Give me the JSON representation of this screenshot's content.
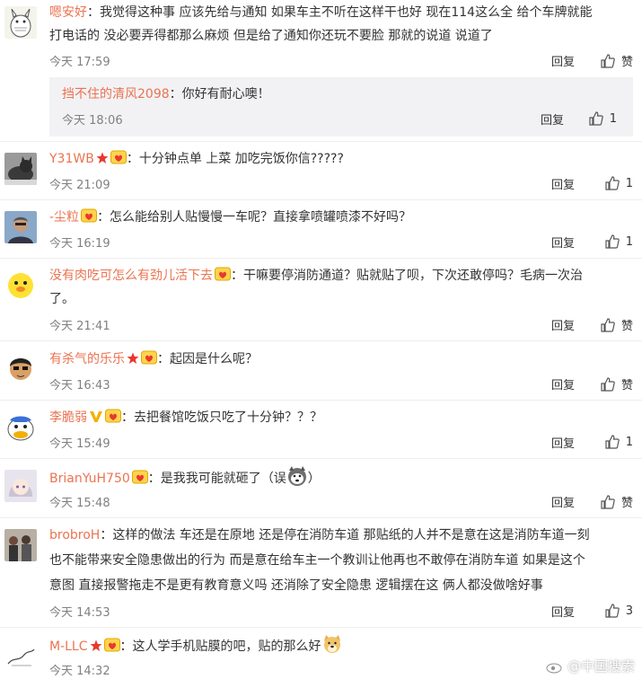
{
  "labels": {
    "reply": "回复"
  },
  "comments": [
    {
      "user": "嗯安好",
      "text": "：我觉得这种事 应该先给与通知 如果车主不听在这样干也好 现在114这么全 给个车牌就能",
      "text2": "打电话的 没必要弄得都那么麻烦 但是给了通知你还玩不要脸 那就的说道 说道了",
      "time": "今天 17:59",
      "likes": "赞",
      "reply": {
        "user": "挡不住的清风2098",
        "text": "：你好有耐心噢！",
        "time": "今天 18:06",
        "likes": "1"
      }
    },
    {
      "user": "Y31WB",
      "text": "：十分钟点单 上菜 加吃完饭你信?????",
      "time": "今天 21:09",
      "likes": "1"
    },
    {
      "user": "-尘粒",
      "text": "：怎么能给别人贴慢慢一车呢？直接拿喷罐喷漆不好吗？",
      "time": "今天 16:19",
      "likes": "1"
    },
    {
      "user": "没有肉吃可怎么有劲儿活下去",
      "text": "：干嘛要停消防通道？贴就贴了呗，下次还敢停吗？毛病一次治",
      "text2": "了。",
      "time": "今天 21:41",
      "likes": "赞"
    },
    {
      "user": "有杀气的乐乐",
      "text": "：起因是什么呢？",
      "time": "今天 16:43",
      "likes": "赞"
    },
    {
      "user": "李脆弱",
      "text": "：去把餐馆吃饭只吃了十分钟？？？",
      "time": "今天 15:49",
      "likes": "1"
    },
    {
      "user": "BrianYuH750",
      "text": "：是我我可能就砸了（误",
      "text_end": "）",
      "time": "今天 15:48",
      "likes": "赞"
    },
    {
      "user": "brobroH",
      "text": "：这样的做法  车还是在原地  还是停在消防车道  那贴纸的人并不是意在这是消防车道一刻",
      "text2": "也不能带来安全隐患做出的行为  而是意在给车主一个教训让他再也不敢停在消防车道  如果是这个",
      "text3": "意图  直接报警拖走不是更有教育意义吗  还消除了安全隐患  逻辑摆在这  俩人都没做啥好事",
      "time": "今天 14:53",
      "likes": "3"
    },
    {
      "user": "M-LLC",
      "text": "：这人学手机贴膜的吧，贴的那么好",
      "time": "今天 14:32",
      "likes": ""
    }
  ],
  "watermark": "@中国搜索",
  "colors": {
    "username": "#eb7350",
    "meta": "#808080",
    "reply_bg": "#f2f2f5"
  }
}
